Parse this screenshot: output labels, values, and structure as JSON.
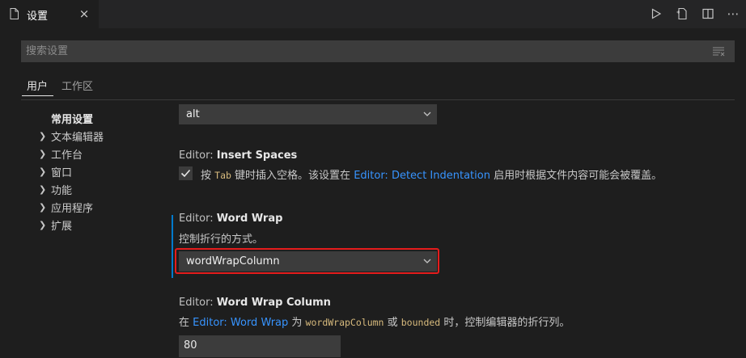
{
  "tab": {
    "title": "设置",
    "close_glyph": "×",
    "icon": "file-icon"
  },
  "actions": [
    "play-icon",
    "open-json-icon",
    "split-editor-icon",
    "more-icon"
  ],
  "more_glyph": "⋯",
  "search": {
    "placeholder": "搜索设置"
  },
  "scopes": {
    "user": "用户",
    "workspace": "工作区"
  },
  "toc": {
    "active": "常用设置",
    "items": [
      "文本编辑器",
      "工作台",
      "窗口",
      "功能",
      "应用程序",
      "扩展"
    ]
  },
  "settings": {
    "prev_dropdown_value": "alt",
    "insert_spaces": {
      "prefix": "Editor: ",
      "name": "Insert Spaces",
      "checked": true,
      "desc_pre": "按 ",
      "desc_code": "Tab",
      "desc_mid": " 键时插入空格。该设置在 ",
      "desc_link": "Editor: Detect Indentation",
      "desc_post": " 启用时根据文件内容可能会被覆盖。"
    },
    "word_wrap": {
      "prefix": "Editor: ",
      "name": "Word Wrap",
      "desc": "控制折行的方式。",
      "value": "wordWrapColumn"
    },
    "word_wrap_column": {
      "prefix": "Editor: ",
      "name": "Word Wrap Column",
      "desc_pre": "在 ",
      "desc_link": "Editor: Word Wrap",
      "desc_mid1": " 为 ",
      "desc_code1": "wordWrapColumn",
      "desc_mid2": " 或 ",
      "desc_code2": "bounded",
      "desc_post": " 时，控制编辑器的折行列。",
      "value": "80"
    }
  },
  "colors": {
    "accent": "#007acc",
    "focus_outline": "#e51c1c",
    "link": "#3794ff"
  }
}
